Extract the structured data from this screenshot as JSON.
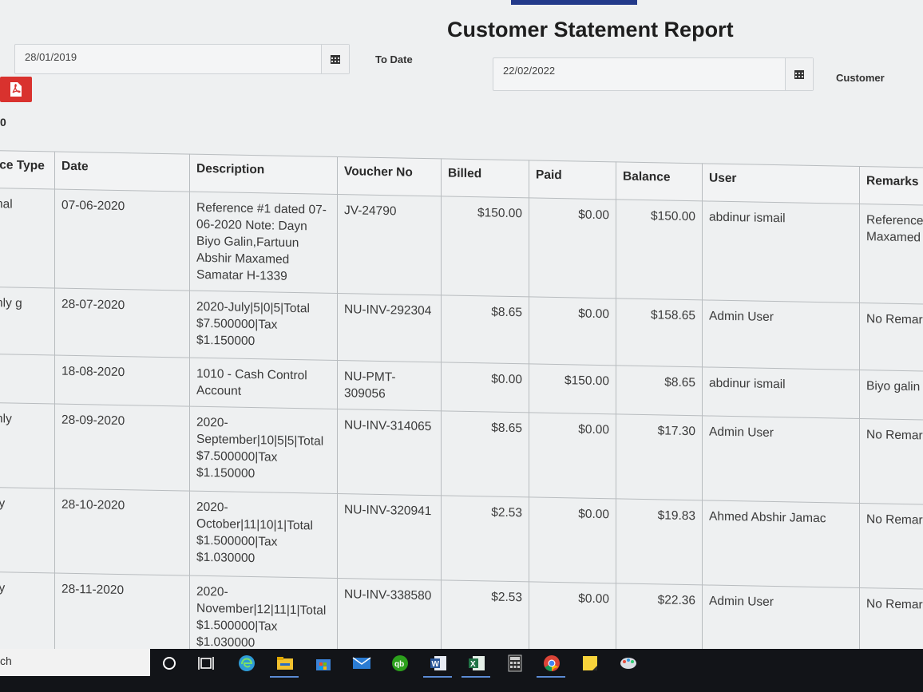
{
  "title": "Customer Statement Report",
  "filters": {
    "from_date": "28/01/2019",
    "to_date_label": "To Date",
    "to_date": "22/02/2022",
    "customer_label": "Customer"
  },
  "count_label": "0",
  "table": {
    "columns": [
      "ice Type",
      "Date",
      "Description",
      "Voucher No",
      "Billed",
      "Paid",
      "Balance",
      "User",
      "Remarks"
    ],
    "rows": [
      {
        "type": "nal",
        "date": "07-06-2020",
        "description": "Reference #1 dated 07-06-2020 Note: Dayn Biyo Galin,Fartuun Abshir Maxamed Samatar H-1339",
        "voucher": "JV-24790",
        "billed": "$150.00",
        "paid": "$0.00",
        "balance": "$150.00",
        "user": "abdinur ismail",
        "remarks": "Reference Maxamed"
      },
      {
        "type": "hly g",
        "date": "28-07-2020",
        "description": "2020-July|5|0|5|Total $7.500000|Tax $1.150000",
        "voucher": "NU-INV-292304",
        "billed": "$8.65",
        "paid": "$0.00",
        "balance": "$158.65",
        "user": "Admin User",
        "remarks": "No Remar"
      },
      {
        "type": "",
        "date": "18-08-2020",
        "description": "1010 - Cash Control Account",
        "voucher": "NU-PMT-309056",
        "billed": "$0.00",
        "paid": "$150.00",
        "balance": "$8.65",
        "user": "abdinur ismail",
        "remarks": "Biyo galin"
      },
      {
        "type": "nly",
        "date": "28-09-2020",
        "description": "2020-September|10|5|5|Total $7.500000|Tax $1.150000",
        "voucher": "NU-INV-314065",
        "billed": "$8.65",
        "paid": "$0.00",
        "balance": "$17.30",
        "user": "Admin User",
        "remarks": "No Remarl"
      },
      {
        "type": "ly",
        "date": "28-10-2020",
        "description": "2020-October|11|10|1|Total $1.500000|Tax $1.030000",
        "voucher": "NU-INV-320941",
        "billed": "$2.53",
        "paid": "$0.00",
        "balance": "$19.83",
        "user": "Ahmed Abshir Jamac",
        "remarks": "No Remark"
      },
      {
        "type": "ly",
        "date": "28-11-2020",
        "description": "2020-November|12|11|1|Total $1.500000|Tax $1.030000",
        "voucher": "NU-INV-338580",
        "billed": "$2.53",
        "paid": "$0.00",
        "balance": "$22.36",
        "user": "Admin User",
        "remarks": "No Remark"
      }
    ]
  },
  "taskbar": {
    "search_text": "ch",
    "icons": [
      "cortana-icon",
      "task-view-icon",
      "edge-icon",
      "file-explorer-icon",
      "store-icon",
      "mail-icon",
      "quickbooks-icon",
      "word-icon",
      "excel-icon",
      "calculator-icon",
      "chrome-icon",
      "sticky-notes-icon",
      "paint-icon"
    ]
  }
}
